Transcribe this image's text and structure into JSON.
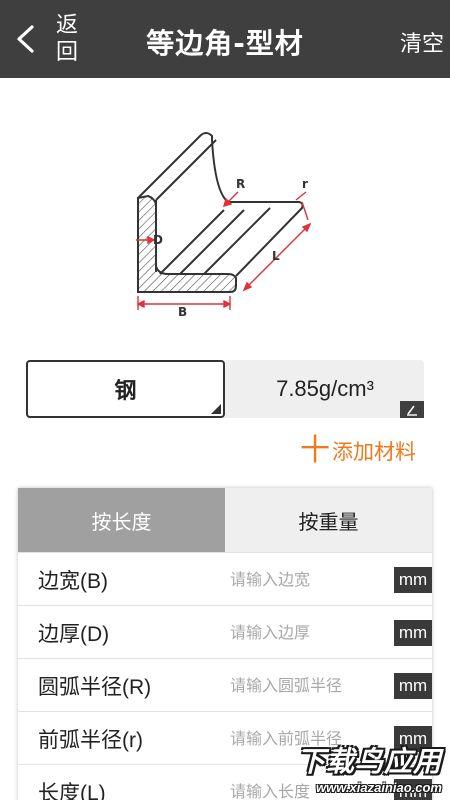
{
  "header": {
    "back_label": "返回",
    "title": "等边角-型材",
    "clear_label": "清空",
    "back_icon": "chevron-left-icon"
  },
  "diagram": {
    "labels": {
      "R": "R",
      "r": "r",
      "D": "D",
      "L": "L",
      "B": "B"
    },
    "accent_color": "#e0303a"
  },
  "material": {
    "name": "钢",
    "density": "7.85g/cm³",
    "edit_icon": "edit-pencil-icon"
  },
  "add_material": {
    "plus": "十",
    "label": "添加材料",
    "color": "#ee7a1e"
  },
  "tabs": [
    {
      "label": "按长度",
      "active": true
    },
    {
      "label": "按重量",
      "active": false
    }
  ],
  "fields": [
    {
      "label": "边宽(B)",
      "placeholder": "请输入边宽",
      "unit": "mm"
    },
    {
      "label": "边厚(D)",
      "placeholder": "请输入边厚",
      "unit": "mm"
    },
    {
      "label": "圆弧半径(R)",
      "placeholder": "请输入圆弧半径",
      "unit": "mm"
    },
    {
      "label": "前弧半径(r)",
      "placeholder": "请输入前弧半径",
      "unit": "mm"
    },
    {
      "label": "长度(L)",
      "placeholder": "请输入长度",
      "unit": "mm"
    }
  ],
  "watermark": {
    "title": "下载鸟应用",
    "url": "www.xiazainiao.com"
  }
}
